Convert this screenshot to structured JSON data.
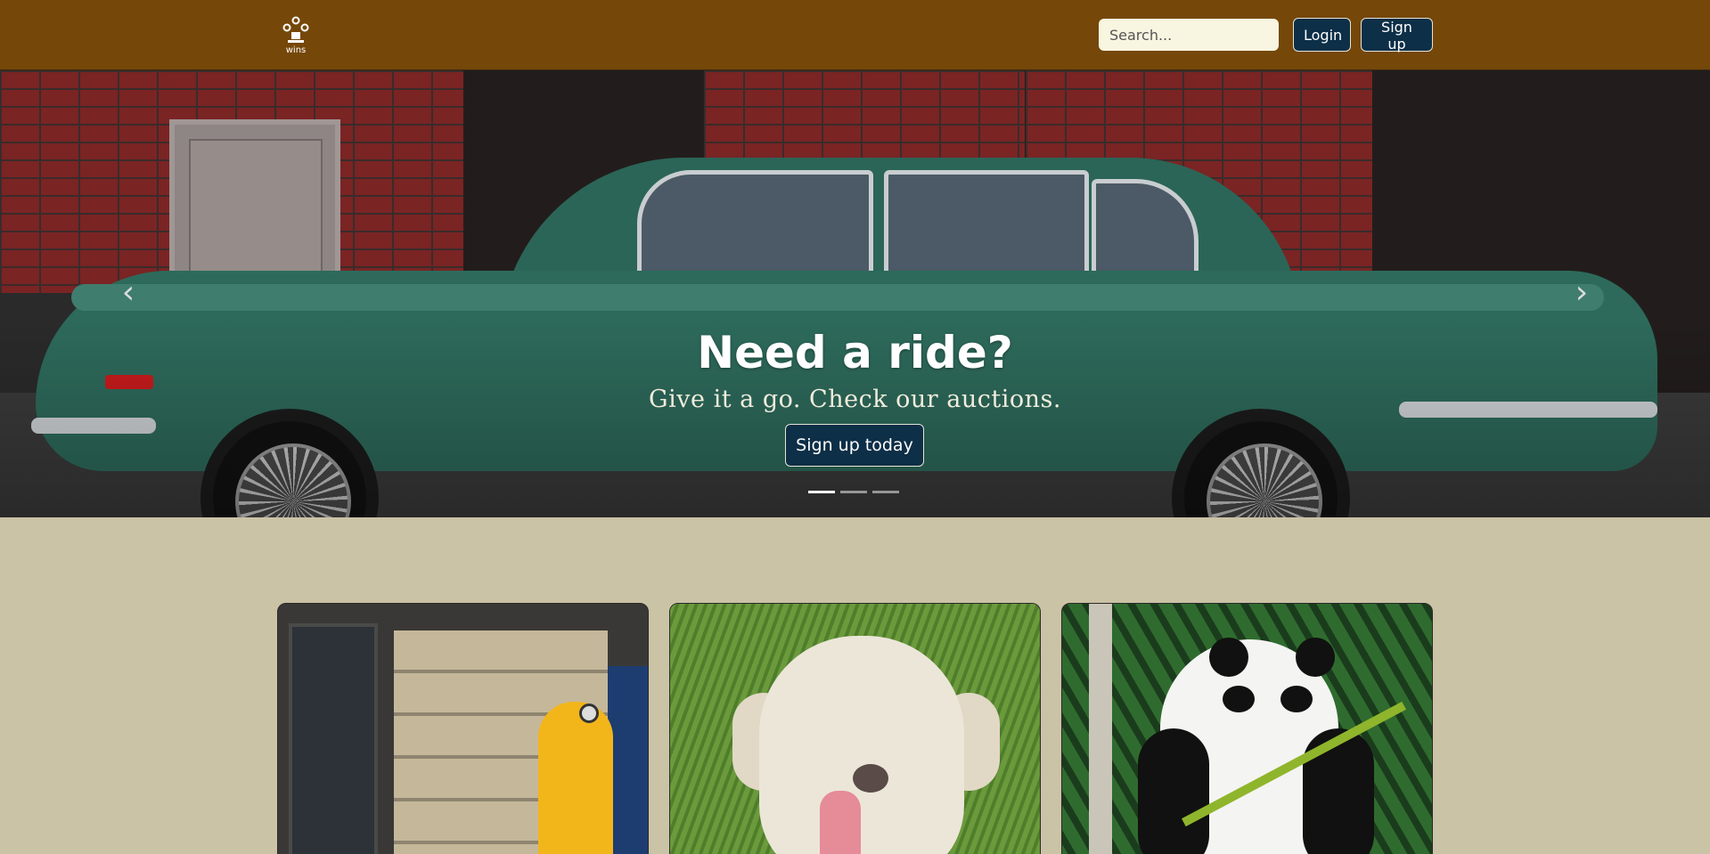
{
  "navbar": {
    "logo_text": "wins",
    "search": {
      "placeholder": "Search...",
      "value": ""
    },
    "login_label": "Login",
    "signup_label": "Sign up",
    "bg_color": "#754709",
    "button_color": "#0d2f47"
  },
  "hero": {
    "title": "Need a ride?",
    "subtitle": "Give it a go. Check our auctions.",
    "cta_label": "Sign up today",
    "prev_icon": "chevron-left-icon",
    "next_icon": "chevron-right-icon",
    "slide_count": 3,
    "active_slide": 1,
    "image_subject": "green classic sedan in front of brick wall"
  },
  "cards": [
    {
      "image_subject": "yellow scooter in front of garage door"
    },
    {
      "image_subject": "white dog lying on grass"
    },
    {
      "image_subject": "panda eating bamboo"
    }
  ],
  "page": {
    "bg_color": "#cbc3a5"
  }
}
